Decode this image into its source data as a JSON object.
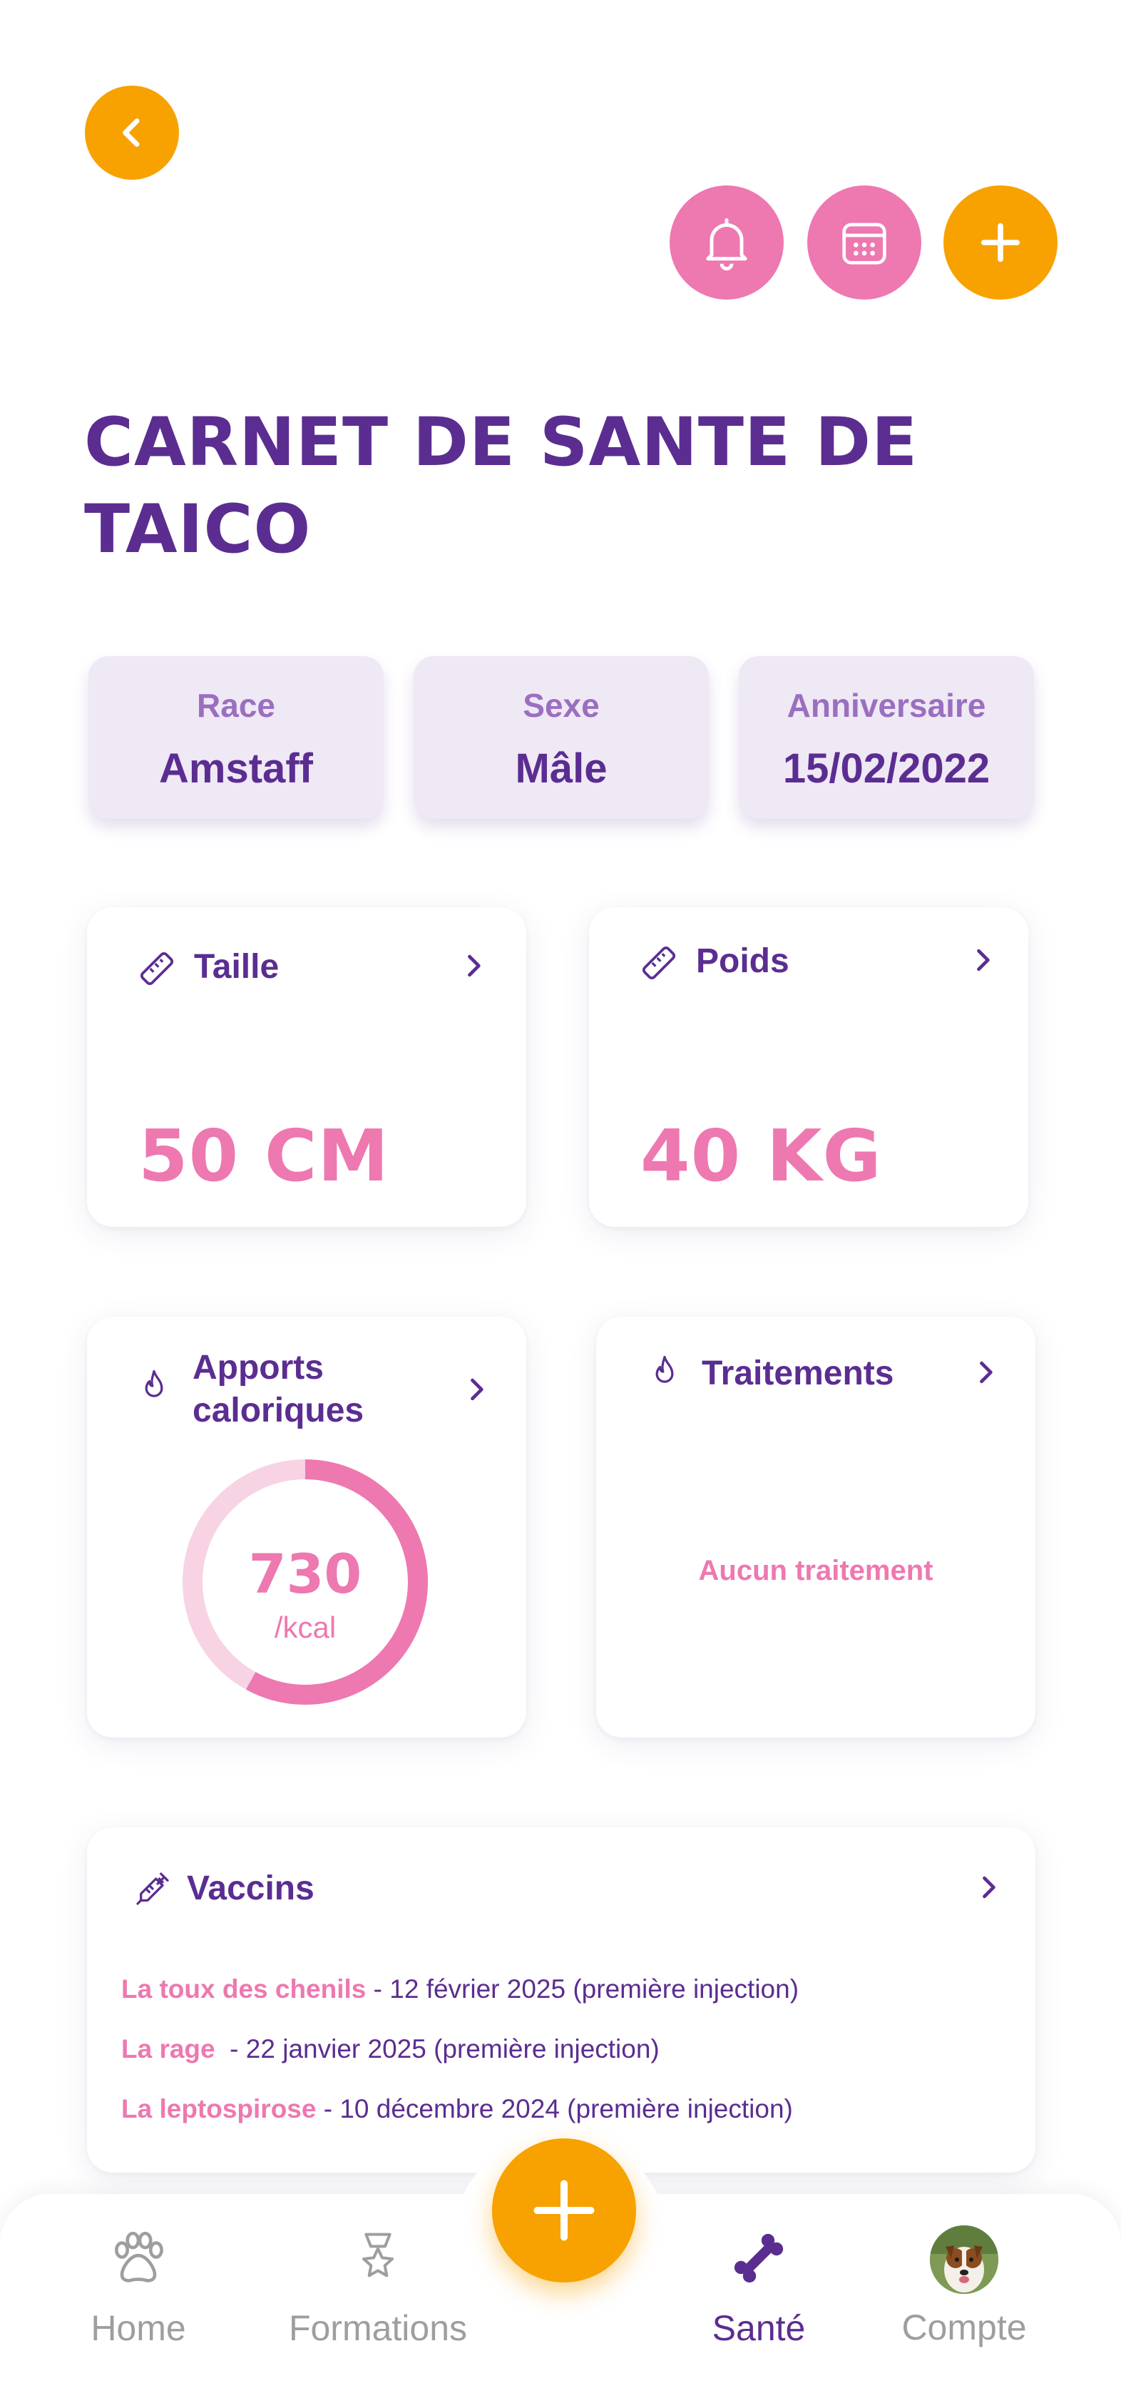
{
  "header": {
    "title": "CARNET DE SANTE DE TAICO",
    "title_line1": "CARNET DE SANTE DE",
    "title_line2": "TAICO",
    "back_icon": "chevron-left-icon",
    "actions": [
      {
        "icon": "bell-icon",
        "color": "#ee78b0"
      },
      {
        "icon": "calendar-icon",
        "color": "#ee78b0"
      },
      {
        "icon": "plus-icon",
        "color": "#f7a200"
      }
    ]
  },
  "info": [
    {
      "label": "Race",
      "value": "Amstaff"
    },
    {
      "label": "Sexe",
      "value": "Mâle"
    },
    {
      "label": "Anniversaire",
      "value": "15/02/2022"
    }
  ],
  "cards": {
    "taille": {
      "title": "Taille",
      "value": "50 CM",
      "icon": "ruler-icon"
    },
    "poids": {
      "title": "Poids",
      "value": "40 KG",
      "icon": "ruler-icon"
    },
    "calories": {
      "title_line1": "Apports",
      "title_line2": "caloriques",
      "value": "730",
      "unit": "/kcal",
      "progress": 0.58,
      "icon": "flame-icon"
    },
    "traitements": {
      "title": "Traitements",
      "empty_text": "Aucun traitement",
      "icon": "flame-icon"
    },
    "vaccins": {
      "title": "Vaccins",
      "icon": "syringe-icon",
      "items": [
        {
          "name": "La toux des chenils",
          "detail": " - 12 février 2025 (première injection)"
        },
        {
          "name": "La rage",
          "detail": "  - 22 janvier 2025 (première injection)"
        },
        {
          "name": "La leptospirose",
          "detail": " - 10 décembre 2024 (première injection)"
        }
      ]
    }
  },
  "nav": {
    "items": [
      {
        "label": "Home",
        "icon": "paw-icon"
      },
      {
        "label": "Formations",
        "icon": "medal-icon"
      },
      {
        "label": "Santé",
        "icon": "bone-icon",
        "active": true
      },
      {
        "label": "Compte",
        "icon": "avatar"
      }
    ],
    "fab_icon": "plus-icon"
  },
  "colors": {
    "accent": "#5b2d91",
    "pink": "#ee78b0",
    "orange": "#f7a200",
    "pill_bg": "#efe8f5"
  }
}
